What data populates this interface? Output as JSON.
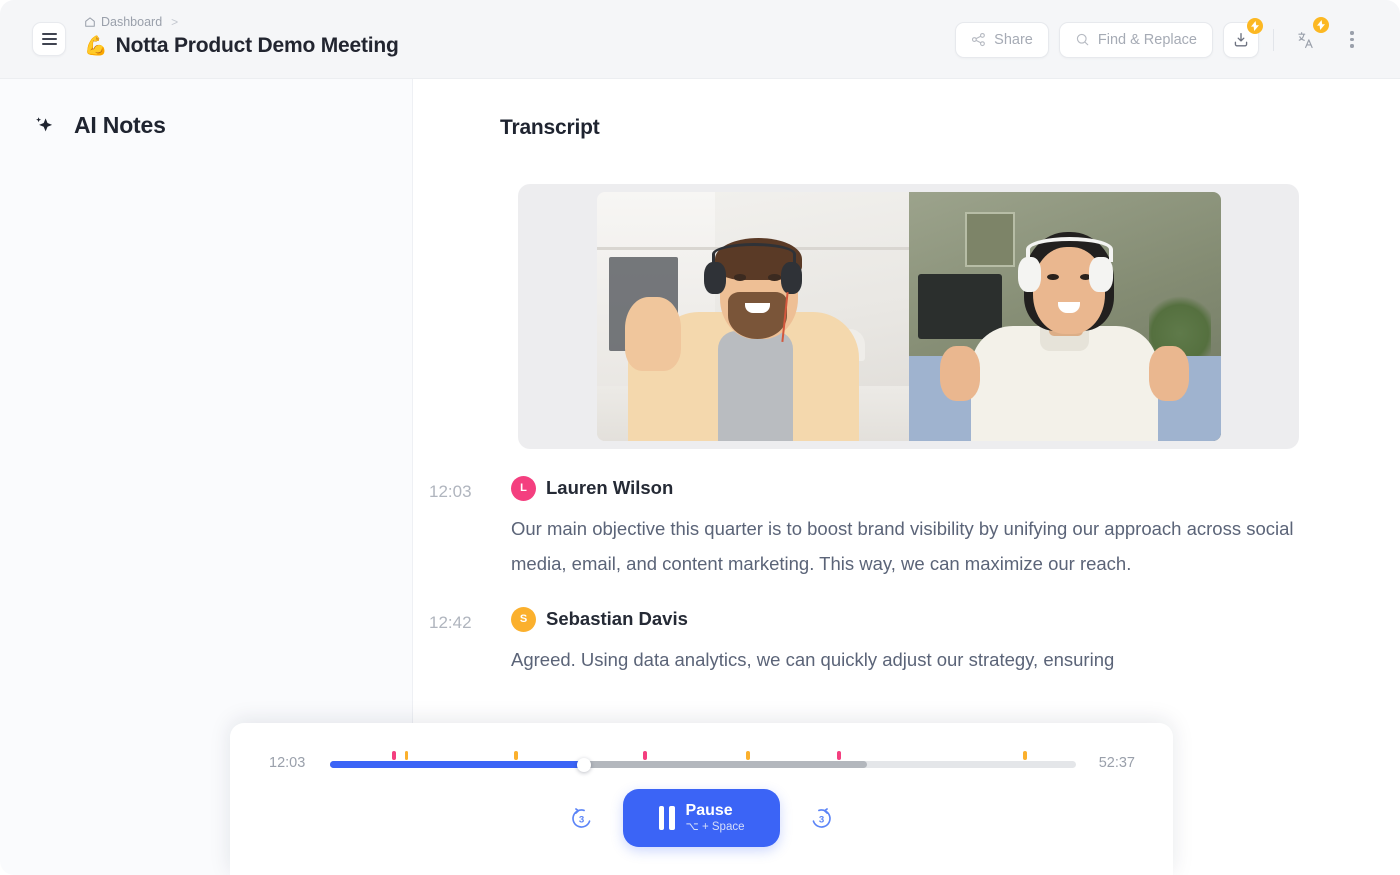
{
  "header": {
    "menu_icon": "hamburger-icon",
    "breadcrumb": {
      "home_icon": "home-icon",
      "parent": "Dashboard",
      "separator": ">"
    },
    "document_emoji": "💪",
    "document_title": "Notta Product Demo Meeting",
    "actions": {
      "share_label": "Share",
      "share_icon": "share-nodes-icon",
      "find_replace_label": "Find & Replace",
      "find_replace_icon": "search-icon",
      "download_icon": "download-icon",
      "download_badge_icon": "bolt-icon",
      "translate_icon": "translate-icon",
      "translate_badge_icon": "bolt-icon",
      "more_icon": "kebab-menu-icon"
    }
  },
  "sidebar": {
    "title": "AI Notes",
    "title_icon": "sparkle-icon"
  },
  "main": {
    "transcript_title": "Transcript",
    "video": {
      "tiles": [
        {
          "participant": "man-waving-headset"
        },
        {
          "participant": "woman-gesturing-headphones"
        }
      ]
    },
    "segments": [
      {
        "time": "12:03",
        "speaker": "Lauren Wilson",
        "initial": "L",
        "avatar_color": "#f43f7f",
        "text": "Our main objective this quarter is to boost brand visibility by unifying our approach across social media, email, and content marketing. This way, we can maximize our reach."
      },
      {
        "time": "12:42",
        "speaker": "Sebastian Davis",
        "initial": "S",
        "avatar_color": "#fbb02d",
        "text": "Agreed. Using data analytics, we can quickly adjust our strategy, ensuring"
      }
    ]
  },
  "player": {
    "current_time": "12:03",
    "total_time": "52:37",
    "progress_percent": 34,
    "buffered_percent": 72,
    "accent_color": "#3b64f6",
    "play_button": {
      "label": "Pause",
      "shortcut": "⌥ + Space",
      "icon": "pause-icon"
    },
    "rewind": {
      "seconds": "3",
      "icon": "rewind-3-icon"
    },
    "forward": {
      "seconds": "3",
      "icon": "forward-3-icon"
    },
    "markers": [
      {
        "position_percent": 8.3,
        "color": "#f43f7f"
      },
      {
        "position_percent": 10.0,
        "color": "#fbb02d"
      },
      {
        "position_percent": 24.7,
        "color": "#fbb02d"
      },
      {
        "position_percent": 42.0,
        "color": "#f43f7f"
      },
      {
        "position_percent": 55.8,
        "color": "#fbb02d"
      },
      {
        "position_percent": 68.0,
        "color": "#f43f7f"
      },
      {
        "position_percent": 92.9,
        "color": "#fbb02d"
      }
    ]
  }
}
